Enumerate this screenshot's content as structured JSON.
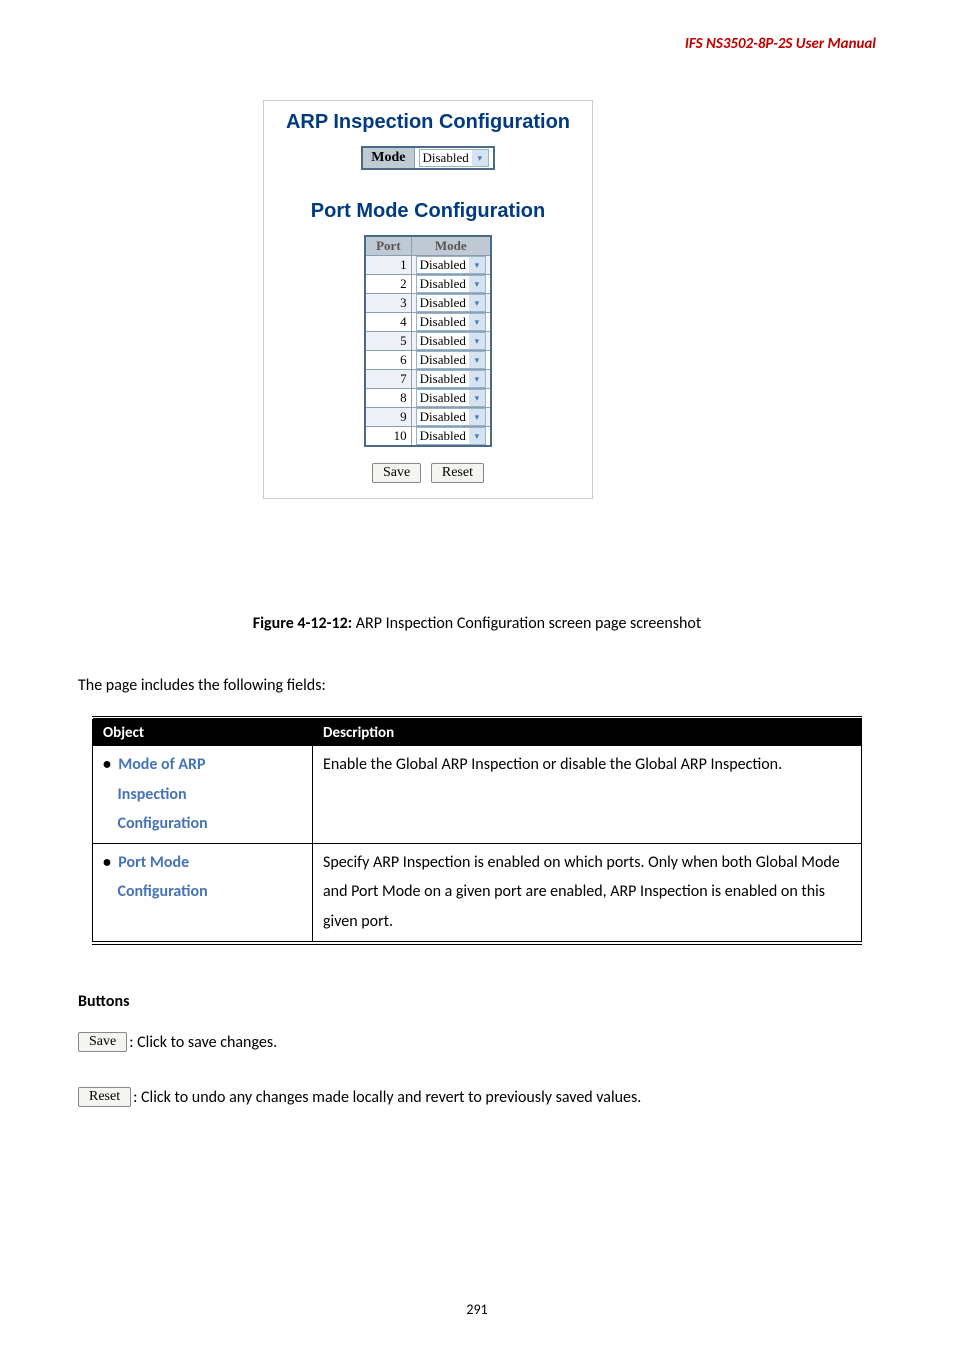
{
  "header": {
    "brand": "IFS  NS3502-8P-2S  User  Manual"
  },
  "screenshot": {
    "title1": "ARP Inspection Configuration",
    "mode_label": "Mode",
    "mode_value": "Disabled",
    "title2": "Port Mode Configuration",
    "port_header": "Port",
    "mode_header": "Mode",
    "ports": [
      {
        "n": "1",
        "m": "Disabled"
      },
      {
        "n": "2",
        "m": "Disabled"
      },
      {
        "n": "3",
        "m": "Disabled"
      },
      {
        "n": "4",
        "m": "Disabled"
      },
      {
        "n": "5",
        "m": "Disabled"
      },
      {
        "n": "6",
        "m": "Disabled"
      },
      {
        "n": "7",
        "m": "Disabled"
      },
      {
        "n": "8",
        "m": "Disabled"
      },
      {
        "n": "9",
        "m": "Disabled"
      },
      {
        "n": "10",
        "m": "Disabled"
      }
    ],
    "save": "Save",
    "reset": "Reset"
  },
  "caption": {
    "bold": "Figure 4-12-12:",
    "rest": " ARP Inspection Configuration screen page screenshot"
  },
  "intro": "The page includes the following fields:",
  "table": {
    "h1": "Object",
    "h2": "Description",
    "rows": [
      {
        "obj_lines": [
          "Mode of ARP",
          "Inspection",
          "Configuration"
        ],
        "desc": "Enable the Global ARP Inspection or disable the Global ARP Inspection."
      },
      {
        "obj_lines": [
          "Port Mode",
          "Configuration"
        ],
        "desc": "Specify ARP Inspection is enabled on which ports. Only when both Global Mode and Port Mode on a given port are enabled, ARP Inspection is enabled on this given port."
      }
    ]
  },
  "buttons_heading": "Buttons",
  "save_btn": {
    "label": "Save",
    "text": ": Click to save changes."
  },
  "reset_btn": {
    "label": "Reset",
    "text": ": Click to undo any changes made locally and revert to previously saved values."
  },
  "page_number": "291"
}
